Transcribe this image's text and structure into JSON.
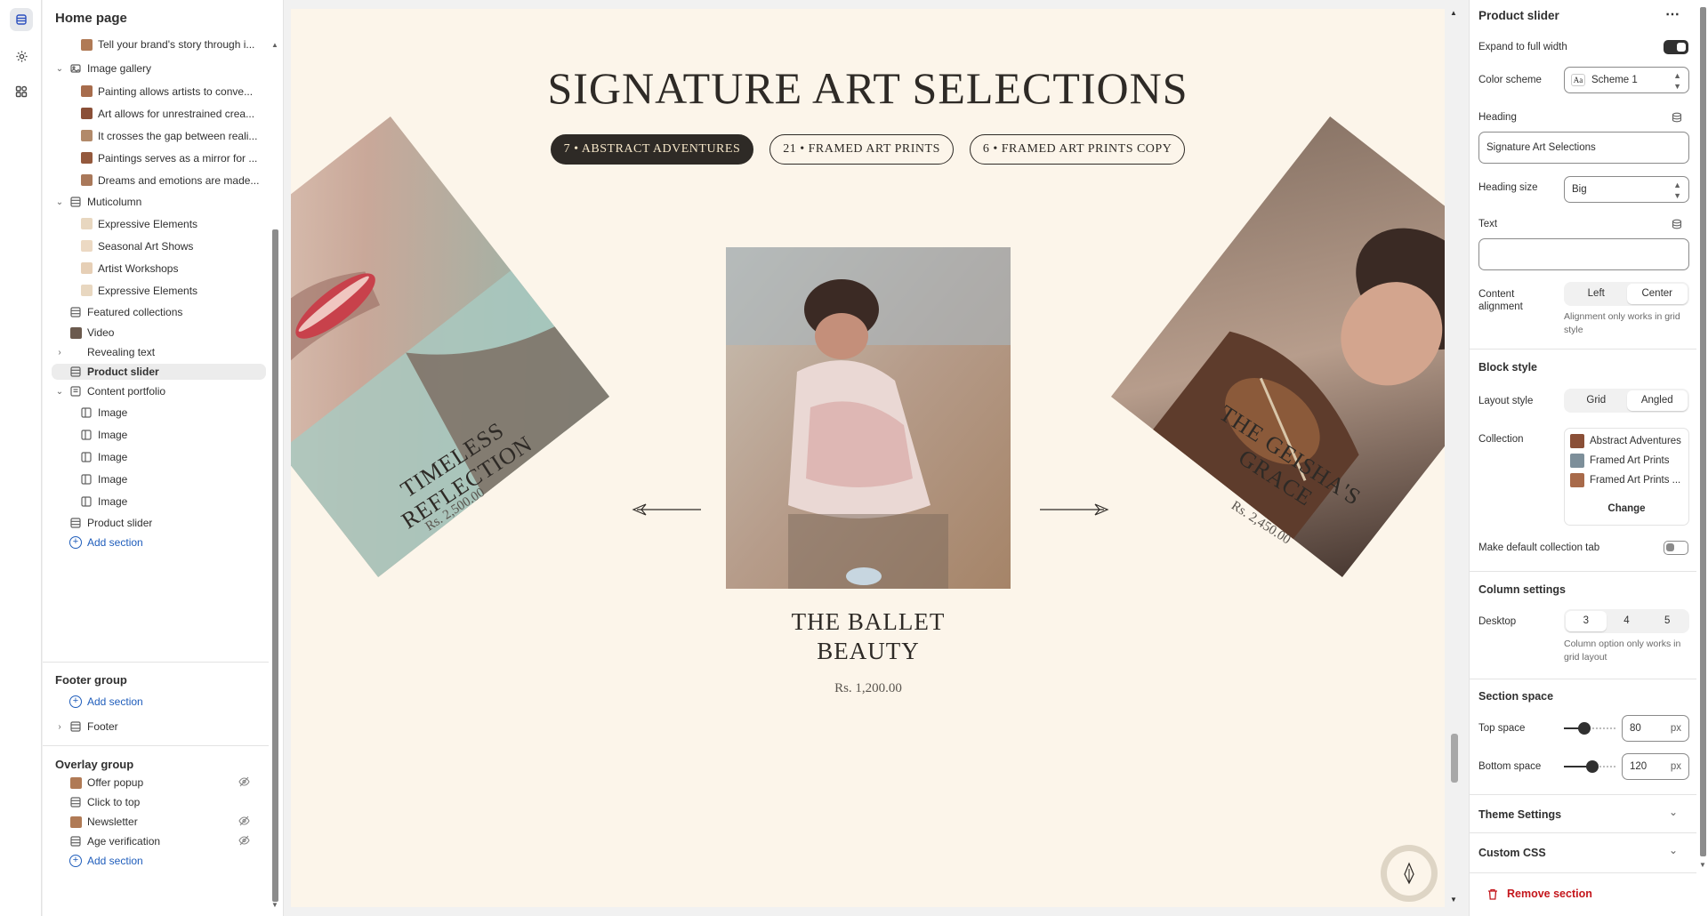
{
  "left": {
    "title": "Home page",
    "tree": [
      {
        "label": "Tell your brand's story through i...",
        "level": 2,
        "kind": "thumb",
        "color": "#b07a55"
      },
      {
        "label": "Image gallery",
        "level": 1,
        "kind": "gallery",
        "chev": "down"
      },
      {
        "label": "Painting allows artists to conve...",
        "level": 2,
        "kind": "thumb",
        "color": "#a76c4c"
      },
      {
        "label": "Art allows for unrestrained crea...",
        "level": 2,
        "kind": "thumb",
        "color": "#8a4f37"
      },
      {
        "label": "It crosses the gap between reali...",
        "level": 2,
        "kind": "thumb",
        "color": "#b28a6a"
      },
      {
        "label": "Paintings serves as a mirror for ...",
        "level": 2,
        "kind": "thumb",
        "color": "#94593d"
      },
      {
        "label": "Dreams and emotions are made...",
        "level": 2,
        "kind": "thumb",
        "color": "#a9785a"
      },
      {
        "label": "Muticolumn",
        "level": 1,
        "kind": "section",
        "chev": "down"
      },
      {
        "label": "Expressive Elements",
        "level": 2,
        "kind": "thumb",
        "color": "#e8d7c0"
      },
      {
        "label": "Seasonal Art Shows",
        "level": 2,
        "kind": "thumb",
        "color": "#ecd9c3"
      },
      {
        "label": "Artist Workshops",
        "level": 2,
        "kind": "thumb",
        "color": "#e6cfb6"
      },
      {
        "label": "Expressive Elements",
        "level": 2,
        "kind": "thumb",
        "color": "#e8d7c0"
      },
      {
        "label": "Featured collections",
        "level": 1,
        "kind": "section"
      },
      {
        "label": "Video",
        "level": 1,
        "kind": "video"
      },
      {
        "label": "Revealing text",
        "level": 1,
        "kind": "blank",
        "chev": "right"
      },
      {
        "label": "Product slider",
        "level": 1,
        "kind": "section",
        "selected": true
      },
      {
        "label": "Content portfolio",
        "level": 1,
        "kind": "doc",
        "chev": "down"
      },
      {
        "label": "Image",
        "level": 2,
        "kind": "image"
      },
      {
        "label": "Image",
        "level": 2,
        "kind": "image"
      },
      {
        "label": "Image",
        "level": 2,
        "kind": "image"
      },
      {
        "label": "Image",
        "level": 2,
        "kind": "image"
      },
      {
        "label": "Image",
        "level": 2,
        "kind": "image"
      },
      {
        "label": "Product slider",
        "level": 1,
        "kind": "section"
      },
      {
        "label": "Add section",
        "level": 1,
        "kind": "add"
      }
    ],
    "footer_group": {
      "title": "Footer group",
      "add": "Add section",
      "footer": "Footer"
    },
    "overlay_group": {
      "title": "Overlay group",
      "items": [
        {
          "label": "Offer popup",
          "kind": "thumb",
          "hidden": true
        },
        {
          "label": "Click to top",
          "kind": "section",
          "hidden": false
        },
        {
          "label": "Newsletter",
          "kind": "thumb",
          "hidden": true
        },
        {
          "label": "Age verification",
          "kind": "section",
          "hidden": true
        }
      ],
      "add": "Add section"
    }
  },
  "preview": {
    "title": "SIGNATURE ART SELECTIONS",
    "tabs": [
      {
        "label": "7 • ABSTRACT ADVENTURES",
        "active": true
      },
      {
        "label": "21 • FRAMED ART PRINTS",
        "active": false
      },
      {
        "label": "6 • FRAMED ART PRINTS COPY",
        "active": false
      }
    ],
    "left_card": {
      "title_line1": "TIMELESS",
      "title_line2": "REFLECTION",
      "price": "Rs. 2,500.00"
    },
    "center_card": {
      "title_line1": "THE BALLET",
      "title_line2": "BEAUTY",
      "price": "Rs. 1,200.00"
    },
    "right_card": {
      "title_line1": "THE GEISHA'S",
      "title_line2": "GRACE",
      "price": "Rs. 2,450.00"
    }
  },
  "settings": {
    "title": "Product slider",
    "expand_label": "Expand to full width",
    "expand_on": true,
    "color_scheme_label": "Color scheme",
    "color_scheme_value": "Scheme 1",
    "color_scheme_swatch": "Aa",
    "heading_label": "Heading",
    "heading_value": "Signature Art Selections",
    "heading_size_label": "Heading size",
    "heading_size_value": "Big",
    "text_label": "Text",
    "text_value": "",
    "content_alignment_label_1": "Content",
    "content_alignment_label_2": "alignment",
    "alignment_options": [
      "Left",
      "Center"
    ],
    "alignment_selected": "Center",
    "alignment_hint": "Alignment only works in grid style",
    "block_style": "Block style",
    "layout_style_label": "Layout style",
    "layout_options": [
      "Grid",
      "Angled"
    ],
    "layout_selected": "Angled",
    "collection_label": "Collection",
    "collections": [
      "Abstract Adventures",
      "Framed Art Prints",
      "Framed Art Prints ..."
    ],
    "change_label": "Change",
    "default_tab_label": "Make default collection tab",
    "default_tab_on": false,
    "column_settings": "Column settings",
    "desktop_label": "Desktop",
    "column_options": [
      "3",
      "4",
      "5"
    ],
    "column_selected": "3",
    "column_hint": "Column option only works in grid layout",
    "section_space": "Section space",
    "top_space_label": "Top space",
    "top_space_value": "80",
    "top_space_fraction": 0.4,
    "bottom_space_label": "Bottom space",
    "bottom_space_value": "120",
    "bottom_space_fraction": 0.55,
    "unit": "px",
    "theme_settings": "Theme Settings",
    "custom_css": "Custom CSS",
    "remove": "Remove section"
  }
}
